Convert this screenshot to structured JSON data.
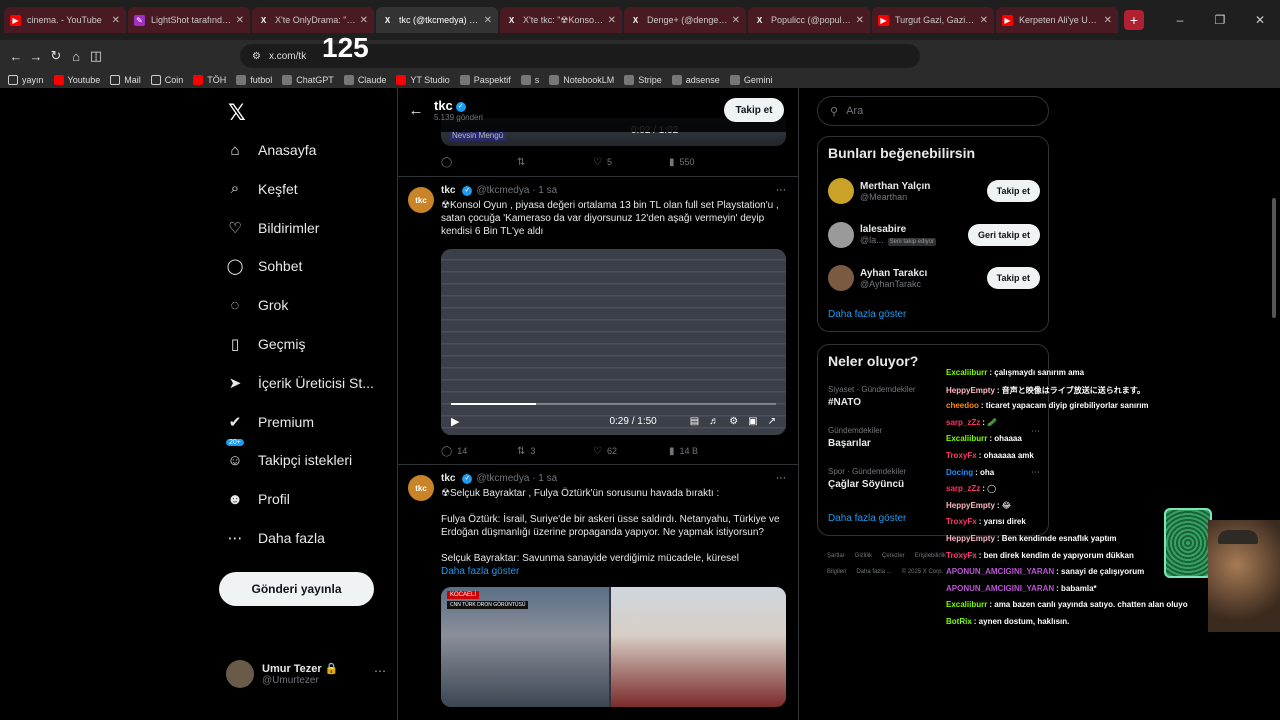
{
  "tabs": [
    {
      "icon": "youtube-icon",
      "title": "cinema. - YouTube",
      "style": "red"
    },
    {
      "icon": "lightshot-icon",
      "title": "LightShot tarafından Ekra",
      "style": "red"
    },
    {
      "icon": "x-icon",
      "title": "X'te OnlyDrama: \"Konsol",
      "style": "red"
    },
    {
      "icon": "x-icon",
      "title": "tkc (@tkcmedya) / X",
      "style": "active"
    },
    {
      "icon": "x-icon",
      "title": "X'te tkc: \"☢Konsol Oyun",
      "style": "red"
    },
    {
      "icon": "x-icon",
      "title": "Denge+ (@dengeplus) / X",
      "style": "red"
    },
    {
      "icon": "x-icon",
      "title": "Populicc (@populicc) / X",
      "style": "red"
    },
    {
      "icon": "youtube-icon",
      "title": "Turgut Gazi, Gazi alpe ba",
      "style": "red"
    },
    {
      "icon": "youtube-icon",
      "title": "Kerpeten Ali'ye Unutama",
      "style": "red"
    }
  ],
  "address": {
    "url": "x.com/tk",
    "counter": "125"
  },
  "bookmarks": [
    "yayın",
    "Youtube",
    "Mail",
    "Coin",
    "TÖH",
    "futbol",
    "ChatGPT",
    "Claude",
    "YT Studio",
    "Paspektif",
    "s",
    "NotebookLM",
    "Stripe",
    "adsense",
    "Gemini"
  ],
  "nav": {
    "items": [
      {
        "label": "Anasayfa",
        "icon": "home-icon",
        "glyph": "⌂"
      },
      {
        "label": "Keşfet",
        "icon": "search-icon",
        "glyph": "⌕"
      },
      {
        "label": "Bildirimler",
        "icon": "bell-icon",
        "glyph": "♡"
      },
      {
        "label": "Sohbet",
        "icon": "chat-icon",
        "glyph": "◯"
      },
      {
        "label": "Grok",
        "icon": "grok-icon",
        "glyph": "◌"
      },
      {
        "label": "Geçmiş",
        "icon": "bookmark-icon",
        "glyph": "▯"
      },
      {
        "label": "İçerik Üreticisi St...",
        "icon": "rocket-icon",
        "glyph": "➤"
      },
      {
        "label": "Premium",
        "icon": "verified-icon",
        "glyph": "✔"
      },
      {
        "label": "Takipçi istekleri",
        "icon": "follower-requests-icon",
        "glyph": "☺",
        "badge": "20+"
      },
      {
        "label": "Profil",
        "icon": "profile-icon",
        "glyph": "☻"
      },
      {
        "label": "Daha fazla",
        "icon": "more-icon",
        "glyph": "⋯"
      }
    ],
    "post_label": "Gönderi yayınla",
    "user": {
      "name": "Umur Tezer 🔒",
      "handle": "@Umurtezer"
    }
  },
  "header": {
    "name": "tkc",
    "posts": "5.139 gönderi",
    "follow": "Takip et"
  },
  "topvideo": {
    "time": "0:02 / 1:02",
    "label": "Nevsin Mengü",
    "stats": {
      "likes": "5",
      "views": "550"
    }
  },
  "tweets": [
    {
      "name": "tkc",
      "handle": "@tkcmedya",
      "time": "· 1 sa",
      "text": "☢Konsol Oyun , piyasa değeri ortalama 13 bin TL olan full set Playstation'u , satan çocuğa  'Kameraso da var diyorsunuz 12'den aşağı vermeyin' deyip kendisi 6 Bin TL'ye aldı",
      "video_time": "0:29 / 1:50",
      "video_progress": 0.26,
      "stats": {
        "replies": "14",
        "reposts": "3",
        "likes": "62",
        "views": "14 B"
      }
    },
    {
      "name": "tkc",
      "handle": "@tkcmedya",
      "time": "· 1 sa",
      "p1": "☢Selçuk Bayraktar , Fulya Öztürk'ün sorusunu havada bıraktı :",
      "p2": "Fulya Öztürk: İsrail, Suriye'de bir askeri üsse saldırdı. Netanyahu, Türkiye ve Erdoğan düşmanlığı üzerine propaganda yapıyor. Ne yapmak istiyorsun?",
      "p3": "Selçuk Bayraktar: Savunma sanayide verdiğimiz mücadele, küresel",
      "more": "Daha fazla göster",
      "tag": "KOCAELİ",
      "tag2": "CNN TÜRK DRON GÖRÜNTÜSÜ"
    }
  ],
  "search": {
    "placeholder": "Ara"
  },
  "suggestions": {
    "title": "Bunları beğenebilirsin",
    "items": [
      {
        "name": "Merthan Yalçın",
        "handle": "@Mearthan",
        "btn": "Takip et",
        "follows_you": ""
      },
      {
        "name": "lalesabire",
        "handle": "@la...",
        "btn": "Geri takip et",
        "follows_you": "Seni takip ediyor"
      },
      {
        "name": "Ayhan Tarakcı",
        "handle": "@AyhanTarakc",
        "btn": "Takip et",
        "follows_you": ""
      }
    ],
    "more": "Daha fazla göster"
  },
  "trends": {
    "title": "Neler oluyor?",
    "items": [
      {
        "category": "Siyaset · Gündemdekiler",
        "topic": "#NATO"
      },
      {
        "category": "Gündemdekiler",
        "topic": "Başarılar"
      },
      {
        "category": "Spor · Gündemdekiler",
        "topic": "Çağlar Söyüncü"
      }
    ],
    "more": "Daha fazla göster"
  },
  "footer": [
    "Şartlar",
    "Gizlilik",
    "Çerezler",
    "Erişilebilirlik",
    "Reklam Bilgileri",
    "Daha fazla ...",
    "© 2025 X Corp."
  ],
  "chat": [
    {
      "user": "Excaliiburr",
      "color": "#7cfc00",
      "msg": ": çalışmaydı sanırım ama"
    },
    {
      "user": "HeppyEmpty",
      "color": "#ffb6c1",
      "msg": ": 音声と映像はライブ放送に送られます。"
    },
    {
      "user": "cheedoo",
      "color": "#ff8c00",
      "msg": ": ticaret yapacam diyip girebiliyorlar sanırım"
    },
    {
      "user": "sarp_zZz",
      "color": "#ff3366",
      "msg": ": 🥒"
    },
    {
      "user": "Excaliiburr",
      "color": "#7cfc00",
      "msg": ": ohaaaa"
    },
    {
      "user": "TroxyFx",
      "color": "#ff3366",
      "msg": ": ohaaaaa amk"
    },
    {
      "user": "Docing",
      "color": "#1e90ff",
      "msg": ": oha"
    },
    {
      "user": "sarp_zZz",
      "color": "#ff3366",
      "msg": ": ◯"
    },
    {
      "user": "HeppyEmpty",
      "color": "#ffb6c1",
      "msg": ": 😂"
    },
    {
      "user": "TroxyFx",
      "color": "#ff3366",
      "msg": ": yarısı direk"
    },
    {
      "user": "HeppyEmpty",
      "color": "#ffb6c1",
      "msg": ": Ben kendimde esnaflık yaptım"
    },
    {
      "user": "TroxyFx",
      "color": "#ff3366",
      "msg": ": ben direk kendim de yapıyorum dükkan"
    },
    {
      "user": "APONUN_AMCIGINI_YARAN",
      "color": "#ba55d3",
      "msg": ": sanayi de çalışıyorum"
    },
    {
      "user": "APONUN_AMCIGINI_YARAN",
      "color": "#ba55d3",
      "msg": ": babamla*"
    },
    {
      "user": "Excaliiburr",
      "color": "#7cfc00",
      "msg": ": ama bazen canlı yayında satıyo. chatten alan oluyo"
    },
    {
      "user": "BotRix",
      "color": "#7cfc00",
      "msg": ": aynen dostum, haklısın."
    }
  ]
}
